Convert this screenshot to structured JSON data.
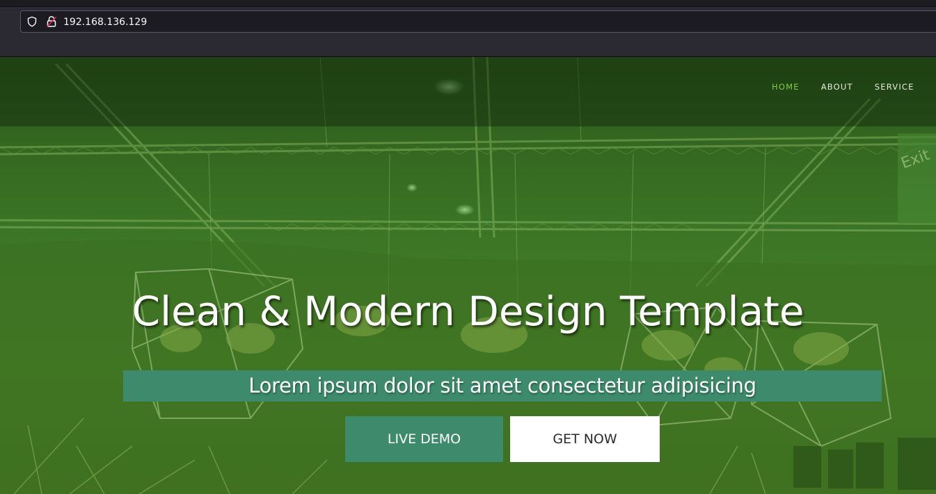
{
  "browser": {
    "url": "192.168.136.129",
    "icons": [
      "shield-icon",
      "insecure-lock-icon"
    ]
  },
  "nav": {
    "items": [
      {
        "label": "HOME",
        "active": true
      },
      {
        "label": "ABOUT",
        "active": false
      },
      {
        "label": "SERVICE",
        "active": false
      }
    ],
    "active_color": "#7dd046"
  },
  "hero": {
    "title": "Clean & Modern Design Template",
    "subtitle": "Lorem ipsum dolor sit amet consectetur adipisicing",
    "buttons": {
      "live_demo": "LIVE DEMO",
      "get_now": "GET NOW"
    },
    "accent_color": "#3d8b6c"
  }
}
